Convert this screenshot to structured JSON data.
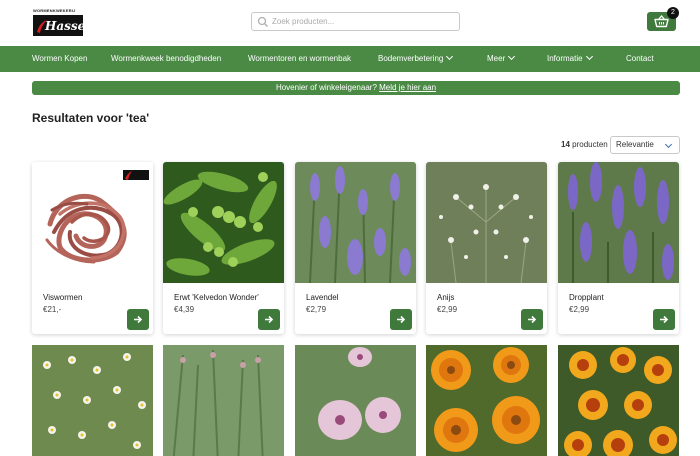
{
  "brand": {
    "logo_top": "WORMENKWEKERIJ",
    "logo_word": "Hasse"
  },
  "search": {
    "placeholder": "Zoek producten..."
  },
  "cart": {
    "count": "2"
  },
  "nav": {
    "items": [
      {
        "label": "Wormen Kopen"
      },
      {
        "label": "Wormenkweek benodigdheden"
      },
      {
        "label": "Wormentoren en wormenbak"
      },
      {
        "label": "Bodemverbetering"
      },
      {
        "label": "Meer"
      },
      {
        "label": "Informatie"
      },
      {
        "label": "Contact"
      }
    ]
  },
  "banner": {
    "text": "Hovenier of winkeleigenaar?",
    "link": "Meld je hier aan"
  },
  "results": {
    "title": "Resultaten voor 'tea'",
    "count_number": "14",
    "count_label": "producten",
    "sort_value": "Relevantie"
  },
  "products": [
    {
      "name": "Viswormen",
      "price": "€21,-"
    },
    {
      "name": "Erwt 'Kelvedon Wonder'",
      "price": "€4,39"
    },
    {
      "name": "Lavendel",
      "price": "€2,79"
    },
    {
      "name": "Anijs",
      "price": "€2,99"
    },
    {
      "name": "Dropplant",
      "price": "€2,99"
    }
  ],
  "colors": {
    "brand_green": "#4a8a45",
    "button_green": "#3f7a3c"
  },
  "icons": {
    "search": "search-icon",
    "cart": "basket-icon",
    "add": "arrow-right-icon"
  }
}
